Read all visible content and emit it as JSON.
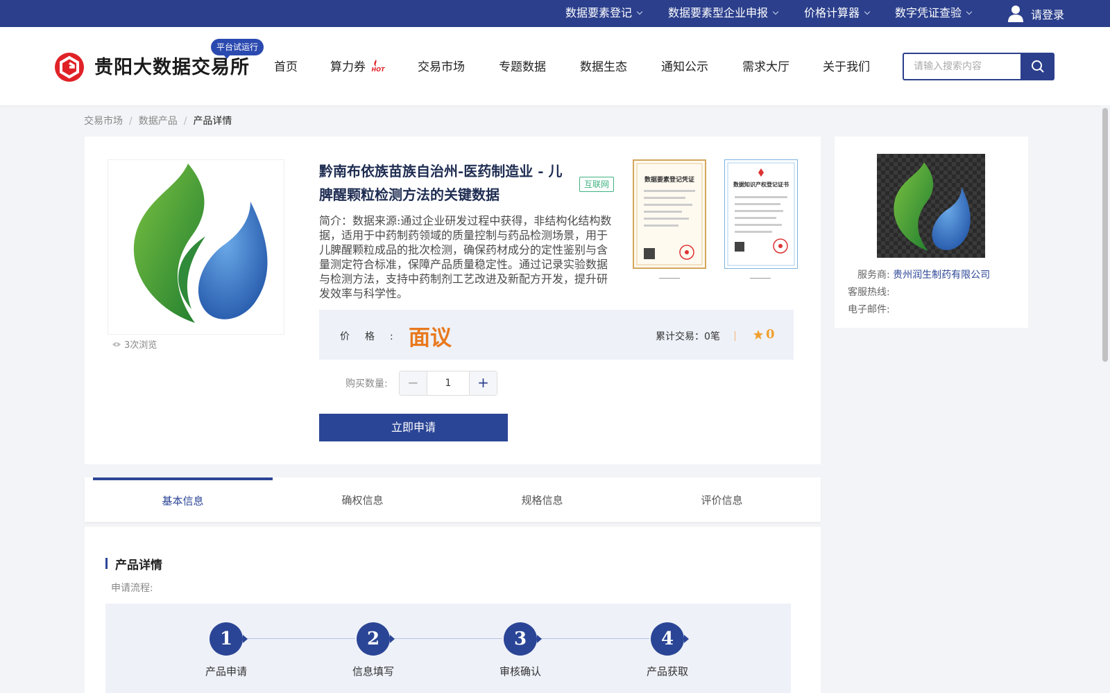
{
  "topbar": {
    "items": [
      {
        "label": "数据要素登记"
      },
      {
        "label": "数据要素型企业申报"
      },
      {
        "label": "价格计算器"
      },
      {
        "label": "数字凭证查验"
      }
    ],
    "login_label": "请登录"
  },
  "header": {
    "logo_text": "贵阳大数据交易所",
    "trial_badge": "平台试运行",
    "nav": [
      {
        "label": "首页"
      },
      {
        "label": "算力券",
        "hot_badge": "HOT"
      },
      {
        "label": "交易市场"
      },
      {
        "label": "专题数据"
      },
      {
        "label": "数据生态"
      },
      {
        "label": "通知公示"
      },
      {
        "label": "需求大厅"
      },
      {
        "label": "关于我们"
      }
    ],
    "search_placeholder": "请输入搜索内容"
  },
  "breadcrumb": {
    "items": [
      "交易市场",
      "数据产品"
    ],
    "separator": "/",
    "current": "产品详情"
  },
  "product": {
    "views": "3次浏览",
    "title": "黔南布依族苗族自治州-医药制造业 - 儿脾醒颗粒检测方法的关键数据",
    "tag": "互联网",
    "description": "简介：数据来源:通过企业研发过程中获得，非结构化结构数据，适用于中药制药领域的质量控制与药品检测场景，用于儿脾醒颗粒成品的批次检测，确保药材成分的定性鉴别与含量测定符合标准，保障产品质量稳定性。通过记录实验数据与检测方法，支持中药制剂工艺改进及新配方开发，提升研发效率与科学性。",
    "certificates": [
      {
        "title": "数据要素登记凭证"
      },
      {
        "title": "数据知识产权登记证书"
      }
    ],
    "price_label": "价格:",
    "price_value": "面议",
    "trade_label": "累计交易：",
    "trade_count": "0笔",
    "rating": "0",
    "qty_label": "购买数量:",
    "qty_value": "1",
    "qty_minus": "−",
    "qty_plus": "+",
    "apply_label": "立即申请"
  },
  "provider": {
    "provider_label": "服务商:",
    "provider_value": "贵州润生制药有限公司",
    "hotline_label": "客服热线:",
    "email_label": "电子邮件:"
  },
  "tabs": [
    {
      "label": "基本信息",
      "active": true
    },
    {
      "label": "确权信息"
    },
    {
      "label": "规格信息"
    },
    {
      "label": "评价信息"
    }
  ],
  "details": {
    "section_title": "产品详情",
    "flow_label": "申请流程:",
    "steps": [
      {
        "num": "1",
        "label": "产品申请"
      },
      {
        "num": "2",
        "label": "信息填写"
      },
      {
        "num": "3",
        "label": "审核确认"
      },
      {
        "num": "4",
        "label": "产品获取"
      }
    ]
  },
  "colors": {
    "brand_navy": "#2b3f8c",
    "accent_blue": "#2b4596",
    "price_orange": "#e8791d",
    "tag_green": "#3fb27f"
  }
}
